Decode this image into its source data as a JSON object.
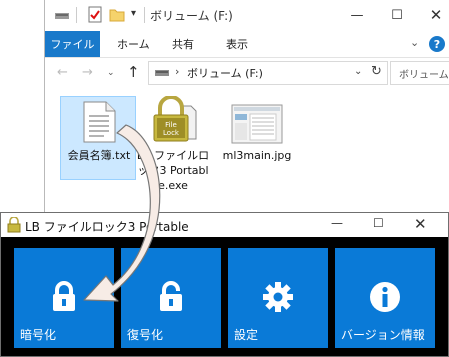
{
  "explorer": {
    "title": "ボリューム (F:)",
    "tabs": {
      "file": "ファイル",
      "home": "ホーム",
      "share": "共有",
      "view": "表示"
    },
    "address": "ボリューム (F:)",
    "search_placeholder": "ボリューム",
    "files": [
      {
        "name": "会員名簿.txt"
      },
      {
        "name": "LB ファイルロック3 Portable.exe"
      },
      {
        "name": "ml3main.jpg"
      }
    ],
    "help": "?"
  },
  "lb_window": {
    "title": "LB ファイルロック3 Portable",
    "tiles": [
      {
        "label": "暗号化",
        "icon": "lock-icon"
      },
      {
        "label": "復号化",
        "icon": "unlock-icon"
      },
      {
        "label": "設定",
        "icon": "gear-icon"
      },
      {
        "label": "バージョン情報",
        "icon": "info-icon"
      }
    ]
  },
  "lock_badge": "File\nLock",
  "colors": {
    "accent": "#0a7ad7",
    "ribbon_file": "#1979ca",
    "selection": "#cce8ff",
    "arrow_fill": "#f7ece6"
  }
}
